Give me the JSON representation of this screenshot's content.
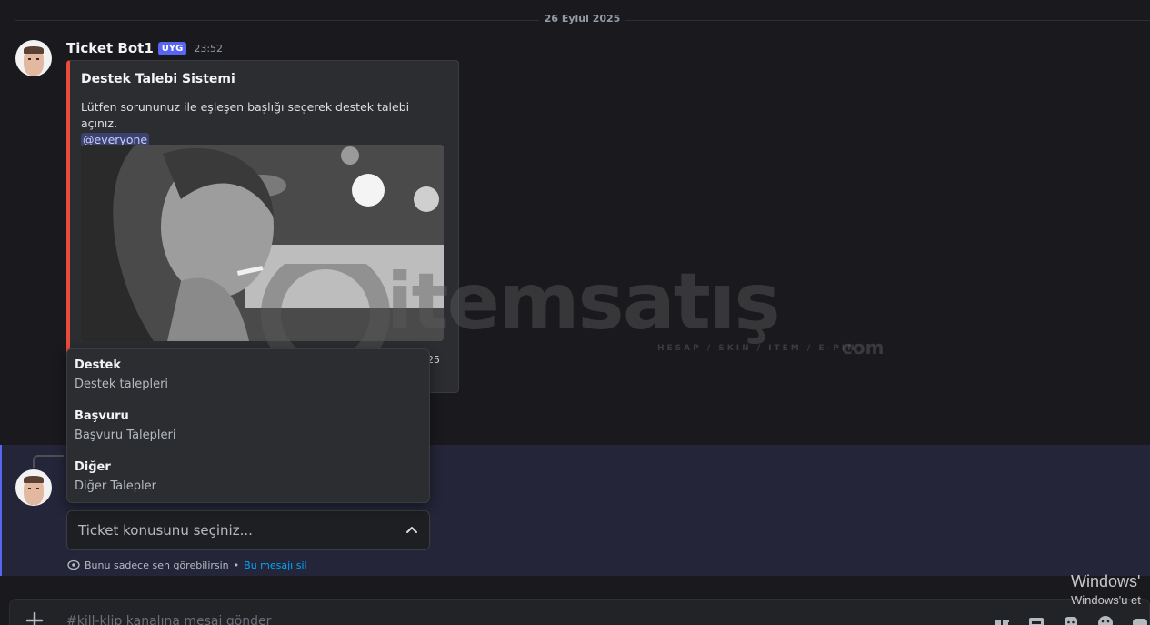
{
  "date_divider": "26 Eylül 2025",
  "message": {
    "author": "Ticket Bot1",
    "badge": "UYG",
    "time": "23:52",
    "embed": {
      "accent_color": "#e74c3c",
      "title": "Destek Talebi Sistemi",
      "description": "Lütfen sorununuz ile eşleşen başlığı seçerek destek talebi açınız.",
      "mention": "@everyone",
      "footer_trail": "25"
    }
  },
  "dropdown": {
    "options": [
      {
        "title": "Destek",
        "subtitle": "Destek talepleri"
      },
      {
        "title": "Başvuru",
        "subtitle": "Başvuru Talepleri"
      },
      {
        "title": "Diğer",
        "subtitle": "Diğer Talepler"
      }
    ]
  },
  "ephemeral": {
    "select_placeholder": "Ticket konusunu seçiniz...",
    "only_you_text": "Bunu sadece sen görebilirsin",
    "separator": "•",
    "dismiss_link": "Bu mesajı sil"
  },
  "composer": {
    "placeholder": "#kill-klip kanalına mesaj gönder",
    "icons": [
      "gift-icon",
      "gif-icon",
      "sticker-icon",
      "emoji-icon",
      "app-icon"
    ]
  },
  "watermark": {
    "word": "itemsatış",
    "tagline": "HESAP / SKIN / ITEM / E-PIN",
    "suffix": "com"
  },
  "windows_activation": {
    "line1": "Windows'",
    "line2": "Windows'u et"
  }
}
